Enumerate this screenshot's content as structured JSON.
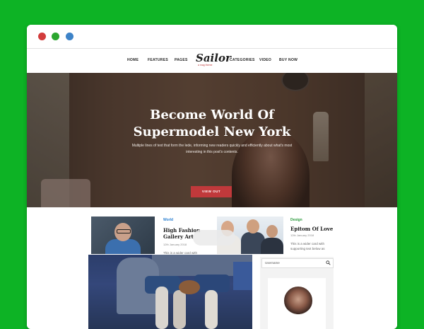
{
  "browser": {
    "dots": [
      "close",
      "minimize",
      "maximize"
    ]
  },
  "nav": {
    "items_left": [
      "HOME",
      "FEATURES",
      "PAGES"
    ],
    "logo": "Sailor",
    "logo_sub": "a mag theme",
    "items_right": [
      "CATEGORIES",
      "VIDEO",
      "BUY NOW"
    ]
  },
  "hero": {
    "title_line1": "Become World Of",
    "title_line2": "Supermodel New York",
    "text_line1": "Multiple lines of text that form the lede, informing new readers quickly and efficiently about what's most",
    "text_line2": "interesting in this post's contents.",
    "button": "VIEW OUT"
  },
  "cards": [
    {
      "category": "World",
      "title_line1": "High Fashion",
      "title_line2": "Gallery Art",
      "date": "12th January 2018",
      "text": "This is a wider card with"
    },
    {
      "category": "Design",
      "title": "Epitom Of Love",
      "date": "12th January 2018",
      "text_line1": "This is a wider card with",
      "text_line2": "supporting text below as"
    }
  ],
  "sidebar": {
    "search_placeholder": "Username"
  },
  "colors": {
    "background": "#0db325",
    "accent": "#c0393b",
    "category_blue": "#2a7fd0",
    "category_green": "#2a9a3c"
  }
}
